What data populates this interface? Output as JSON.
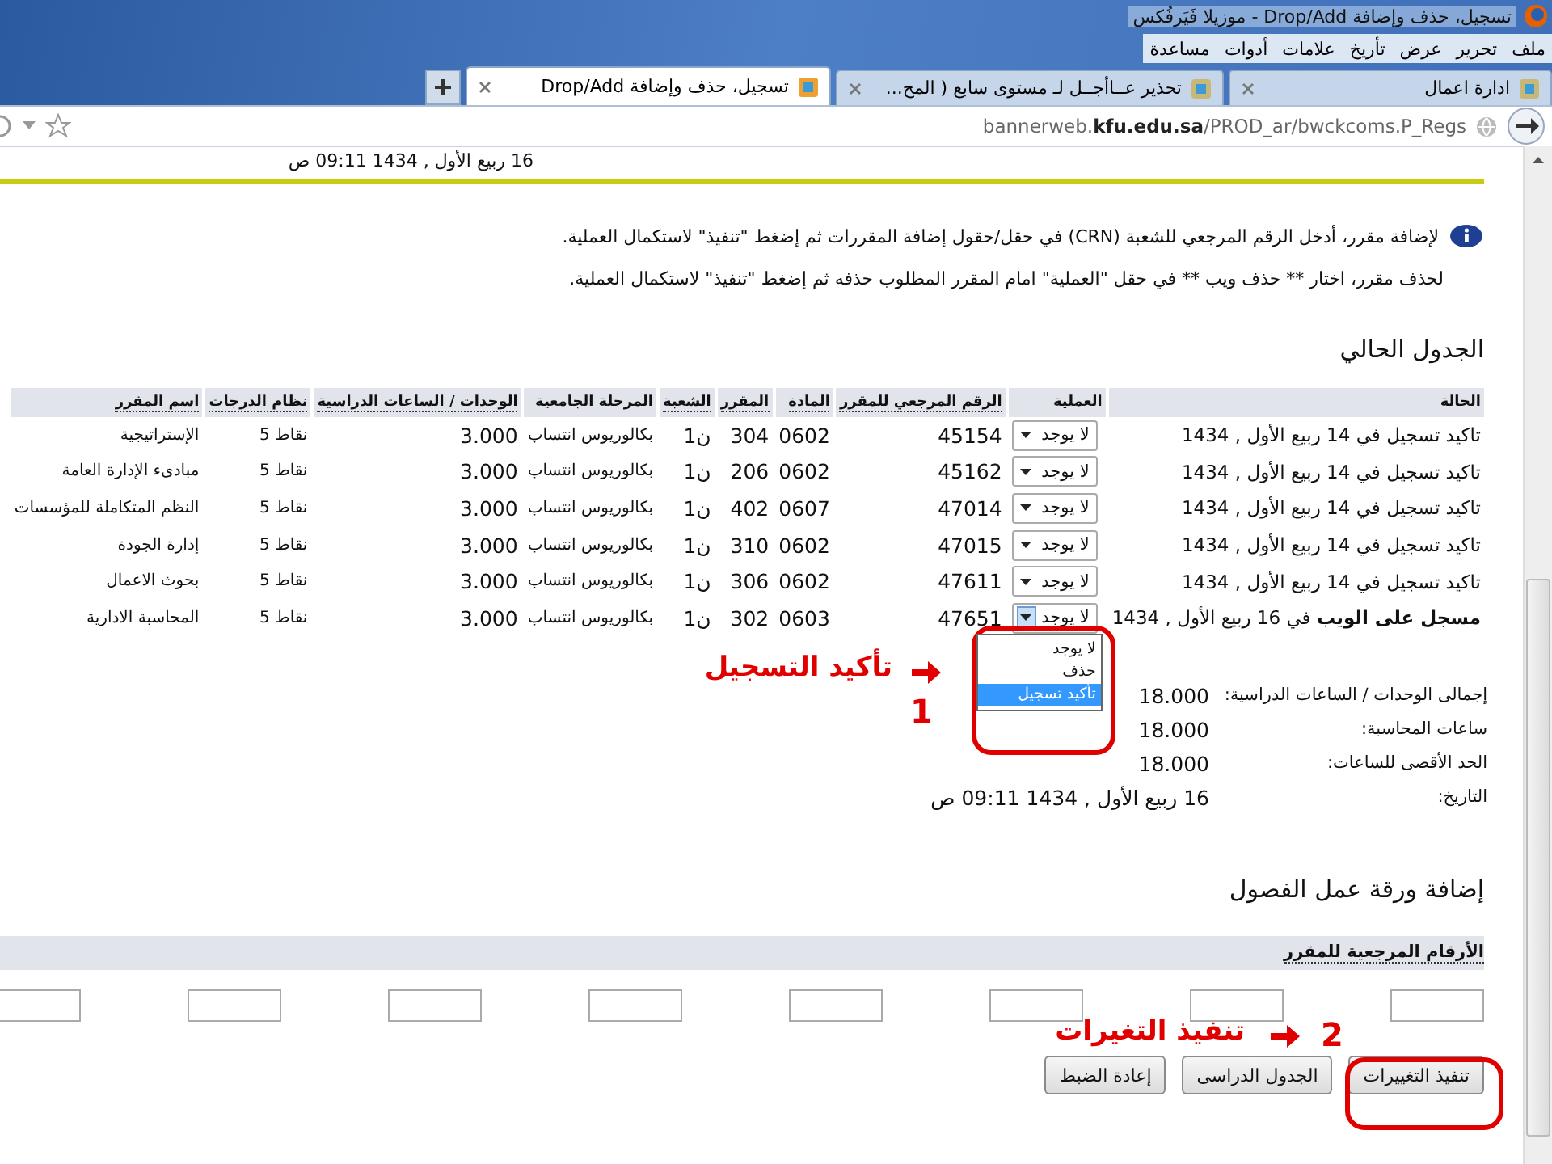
{
  "window": {
    "title": "تسجيل، حذف وإضافة Drop/Add - موزيلا فَيَرفُكس",
    "menu": [
      "ملف",
      "تحرير",
      "عرض",
      "تأريخ",
      "علامات",
      "أدوات",
      "مساعدة"
    ],
    "tabs": [
      {
        "label": "ادارة اعمال",
        "selected": false
      },
      {
        "label": "تحذير عــاأجــل لـ مستوى سابع ( المح...",
        "selected": false
      },
      {
        "label": "تسجيل، حذف وإضافة Drop/Add",
        "selected": true
      }
    ],
    "address_bar": {
      "url": "bannerweb.**kfu.edu.sa**/PROD_ar/bwckcoms.P_Regs"
    }
  },
  "page": {
    "top_date": "16 ربيع الأول , 1434 09:11 ص",
    "info": [
      "لإضافة مقرر، أدخل الرقم المرجعي للشعبة (CRN) في حقل/حقول إضافة المقررات ثم إضغط \"تنفيذ\" لاستكمال العملية.",
      "لحذف مقرر، اختار ** حذف ويب ** في حقل \"العملية\" امام المقرر المطلوب حذفه ثم إضغط \"تنفيذ\" لاستكمال العملية."
    ],
    "schedule_title": "الجدول الحالي",
    "table": {
      "columns": [
        "الحالة",
        "العملية",
        "الرقم المرجعي للمقرر",
        "المادة",
        "المقرر",
        "الشعبة",
        "المرحلة الجامعية",
        "الوحدات / الساعات الدراسية",
        "نظام الدرجات",
        "اسم المقرر"
      ],
      "rows": [
        {
          "status": "تاكيد تسجيل في 14 ربيع الأول , 1434",
          "action": "لا يوجد",
          "expanded": false,
          "crn": "45154",
          "subject": "0602",
          "course": "304",
          "section": "ن1",
          "level": "بكالوريوس انتساب",
          "units": "3.000",
          "grade_mode": "نقاط 5",
          "title": "الإستراتيجية"
        },
        {
          "status": "تاكيد تسجيل في 14 ربيع الأول , 1434",
          "action": "لا يوجد",
          "expanded": false,
          "crn": "45162",
          "subject": "0602",
          "course": "206",
          "section": "ن1",
          "level": "بكالوريوس انتساب",
          "units": "3.000",
          "grade_mode": "نقاط 5",
          "title": "مبادىء الإدارة العامة"
        },
        {
          "status": "تاكيد تسجيل في 14 ربيع الأول , 1434",
          "action": "لا يوجد",
          "expanded": false,
          "crn": "47014",
          "subject": "0607",
          "course": "402",
          "section": "ن1",
          "level": "بكالوريوس انتساب",
          "units": "3.000",
          "grade_mode": "نقاط 5",
          "title": "النظم المتكاملة للمؤسسات"
        },
        {
          "status": "تاكيد تسجيل في 14 ربيع الأول , 1434",
          "action": "لا يوجد",
          "expanded": false,
          "crn": "47015",
          "subject": "0602",
          "course": "310",
          "section": "ن1",
          "level": "بكالوريوس انتساب",
          "units": "3.000",
          "grade_mode": "نقاط 5",
          "title": "إدارة الجودة"
        },
        {
          "status": "تاكيد تسجيل في 14 ربيع الأول , 1434",
          "action": "لا يوجد",
          "expanded": false,
          "crn": "47611",
          "subject": "0602",
          "course": "306",
          "section": "ن1",
          "level": "بكالوريوس انتساب",
          "units": "3.000",
          "grade_mode": "نقاط 5",
          "title": "بحوث الاعمال"
        },
        {
          "status": "**مسجل على الويب** في 16 ربيع الأول , 1434",
          "action": "لا يوجد",
          "expanded": true,
          "crn": "47651",
          "subject": "0603",
          "course": "302",
          "section": "ن1",
          "level": "بكالوريوس انتساب",
          "units": "3.000",
          "grade_mode": "نقاط 5",
          "title": "المحاسبة الادارية"
        }
      ],
      "action_options": [
        {
          "label": "لا يوجد",
          "selected": false
        },
        {
          "label": "حذف",
          "selected": false
        },
        {
          "label": "تأكيد تسجيل",
          "selected": true
        }
      ]
    },
    "totals": [
      {
        "label": "إجمالى الوحدات / الساعات الدراسية:",
        "value": "18.000"
      },
      {
        "label": "ساعات المحاسبة:",
        "value": "18.000"
      },
      {
        "label": "الحد الأقصى للساعات:",
        "value": "18.000"
      },
      {
        "label": "التاريخ:",
        "value": "16 ربيع الأول , 1434 09:11 ص"
      }
    ],
    "add_title": "إضافة ورقة عمل الفصول",
    "crn_header": "الأرقام المرجعية للمقرر",
    "buttons": [
      "تنفيذ التغييرات",
      "الجدول الدراسى",
      "إعادة الضبط"
    ],
    "annotations": [
      {
        "number": "1",
        "label": "تأكيد التسجيل"
      },
      {
        "number": "2",
        "label": "تنفيذ التغيرات"
      }
    ]
  }
}
